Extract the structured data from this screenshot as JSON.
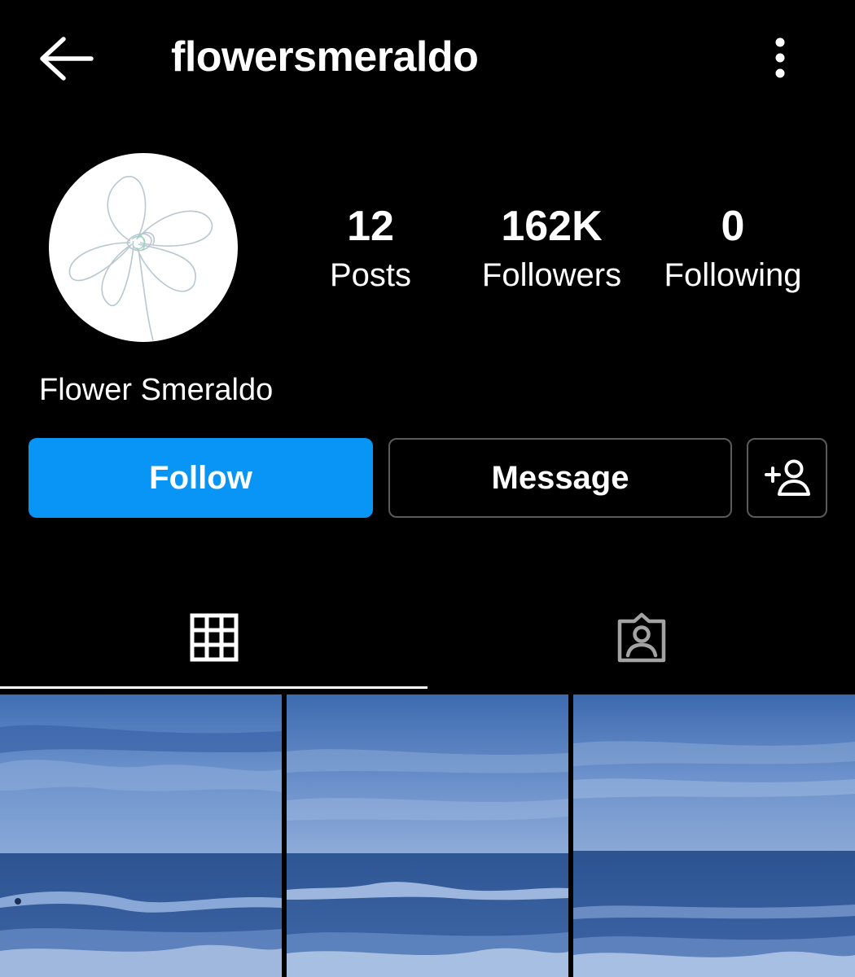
{
  "header": {
    "username": "flowersmeraldo",
    "back_icon": "arrow-left-icon",
    "more_icon": "more-vertical-icon"
  },
  "profile": {
    "avatar_icon": "flower-sketch-icon",
    "display_name": "Flower Smeraldo",
    "stats": {
      "posts": {
        "value": "12",
        "label": "Posts"
      },
      "followers": {
        "value": "162K",
        "label": "Followers"
      },
      "following": {
        "value": "0",
        "label": "Following"
      }
    }
  },
  "actions": {
    "follow_label": "Follow",
    "message_label": "Message",
    "suggest_icon": "add-person-icon"
  },
  "tabs": {
    "grid_icon": "grid-icon",
    "tagged_icon": "tagged-person-icon",
    "active": "grid"
  },
  "colors": {
    "background": "#000000",
    "follow_button": "#0895f6",
    "border": "#5a5a5a",
    "photo_tint": "#4f78b8"
  },
  "posts": [
    {
      "subject": "ocean-horizon"
    },
    {
      "subject": "ocean-horizon"
    },
    {
      "subject": "ocean-horizon"
    }
  ]
}
